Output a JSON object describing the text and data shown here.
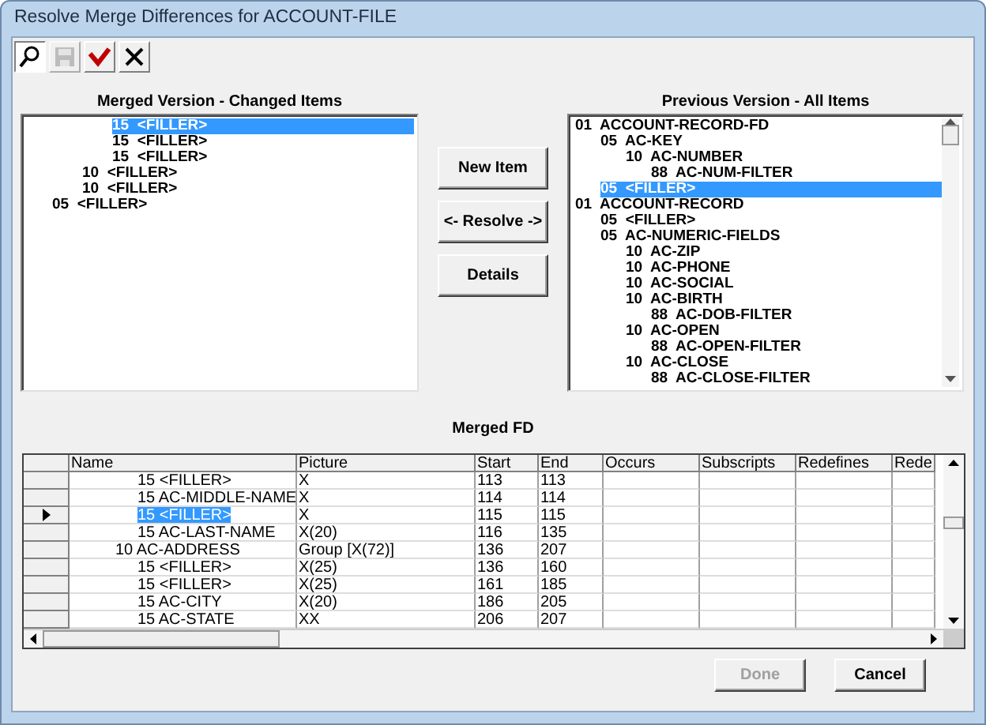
{
  "window": {
    "title": "Resolve Merge Differences for ACCOUNT-FILE"
  },
  "toolbar": [
    {
      "kind": "find",
      "disabled": false
    },
    {
      "kind": "save",
      "disabled": true
    },
    {
      "kind": "check",
      "disabled": false
    },
    {
      "kind": "close",
      "disabled": false
    }
  ],
  "merged_list": {
    "label": "Merged Version - Changed Items",
    "items": [
      {
        "children": [
          {
            "children": [
              {
                "text": "15  <FILLER>",
                "selected": true
              },
              {
                "text": "15  <FILLER>",
                "selected": false
              },
              {
                "text": "15  <FILLER>",
                "selected": false
              }
            ]
          },
          {
            "text": "10  <FILLER>",
            "selected": false
          },
          {
            "text": "10  <FILLER>",
            "selected": false
          }
        ]
      },
      {
        "text": "05  <FILLER>",
        "selected": false
      }
    ]
  },
  "actions": [
    {
      "label": "New Item"
    },
    {
      "label": "<- Resolve ->"
    },
    {
      "label": "Details"
    }
  ],
  "previous_list": {
    "label": "Previous Version - All Items",
    "items": [
      {
        "text": "01  ACCOUNT-RECORD-FD",
        "selected": false,
        "children": [
          {
            "text": "05  AC-KEY",
            "selected": false,
            "children": [
              {
                "text": "10  AC-NUMBER",
                "selected": false,
                "children": [
                  {
                    "text": "88  AC-NUM-FILTER",
                    "selected": false
                  }
                ]
              }
            ]
          },
          {
            "text": "05  <FILLER>",
            "selected": true
          }
        ]
      },
      {
        "text": "01  ACCOUNT-RECORD",
        "selected": false,
        "children": [
          {
            "text": "05  <FILLER>",
            "selected": false
          },
          {
            "text": "05  AC-NUMERIC-FIELDS",
            "selected": false,
            "children": [
              {
                "text": "10  AC-ZIP",
                "selected": false
              },
              {
                "text": "10  AC-PHONE",
                "selected": false
              },
              {
                "text": "10  AC-SOCIAL",
                "selected": false
              },
              {
                "text": "10  AC-BIRTH",
                "selected": false,
                "children": [
                  {
                    "text": "88  AC-DOB-FILTER",
                    "selected": false
                  }
                ]
              },
              {
                "text": "10  AC-OPEN",
                "selected": false,
                "children": [
                  {
                    "text": "88  AC-OPEN-FILTER",
                    "selected": false
                  }
                ]
              },
              {
                "text": "10  AC-CLOSE",
                "selected": false,
                "children": [
                  {
                    "text": "88  AC-CLOSE-FILTER",
                    "selected": false
                  }
                ]
              }
            ]
          }
        ]
      }
    ]
  },
  "grid": {
    "title": "Merged FD",
    "columns": [
      "Name",
      "Picture",
      "Start",
      "End",
      "Occurs",
      "Subscripts",
      "Redefines",
      "Rede"
    ],
    "rows": [
      {
        "kind": "field",
        "current": false,
        "selected": false,
        "cells": [
          "15 <FILLER>",
          "X",
          "113",
          "113"
        ]
      },
      {
        "kind": "field",
        "current": false,
        "selected": false,
        "cells": [
          "15 AC-MIDDLE-NAME",
          "X",
          "114",
          "114"
        ]
      },
      {
        "kind": "field",
        "current": true,
        "selected": true,
        "cells": [
          "15 <FILLER>",
          "X",
          "115",
          "115"
        ]
      },
      {
        "kind": "field",
        "current": false,
        "selected": false,
        "cells": [
          "15 AC-LAST-NAME",
          "X(20)",
          "116",
          "135"
        ]
      },
      {
        "kind": "group",
        "current": false,
        "selected": false,
        "cells": [
          "10 AC-ADDRESS",
          "Group [X(72)]",
          "136",
          "207"
        ]
      },
      {
        "kind": "field",
        "current": false,
        "selected": false,
        "cells": [
          "15 <FILLER>",
          "X(25)",
          "136",
          "160"
        ]
      },
      {
        "kind": "field",
        "current": false,
        "selected": false,
        "cells": [
          "15 <FILLER>",
          "X(25)",
          "161",
          "185"
        ]
      },
      {
        "kind": "field",
        "current": false,
        "selected": false,
        "cells": [
          "15 AC-CITY",
          "X(20)",
          "186",
          "205"
        ]
      },
      {
        "kind": "field",
        "current": false,
        "selected": false,
        "cells": [
          "15 AC-STATE",
          "XX",
          "206",
          "207"
        ]
      }
    ]
  },
  "buttons": [
    {
      "label": "Done",
      "disabled": true
    },
    {
      "label": "Cancel",
      "disabled": false
    }
  ]
}
